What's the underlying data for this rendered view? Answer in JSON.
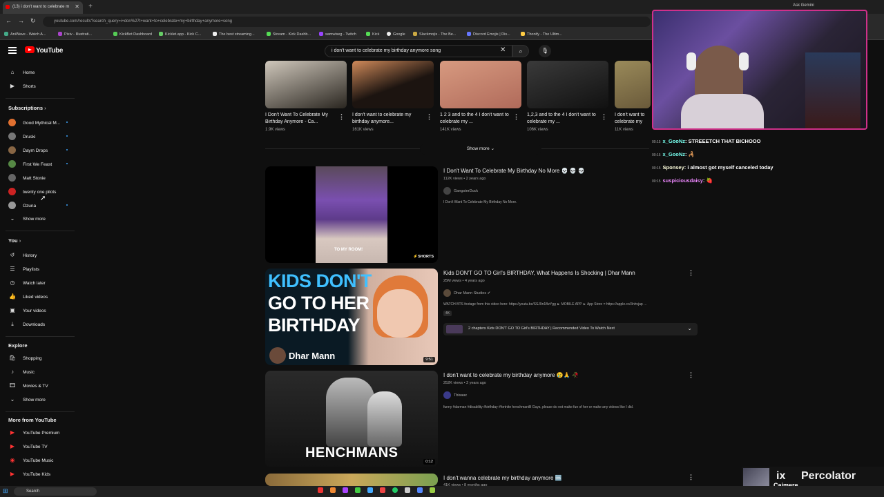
{
  "browser": {
    "tab_title": "(13) i don't want to celebrate m",
    "url": "youtube.com/results?search_query=i+don%27t+want+to+celebrate+my+birthday+anymore+song",
    "ask_gemini": "Ask Gemini",
    "bookmarks": [
      "AniWave - Watch A...",
      "Pixiv - Illustrati...",
      "KickBot Dashboard",
      "Kicklet.app - Kick C...",
      "The best streaming...",
      "Stream - Kick Dashb...",
      "samwiseg - Twitch",
      "Kick",
      "Google",
      "Slackmojis - The Be...",
      "Discord Emojis | Dis...",
      "Thonify - The Ultim..."
    ]
  },
  "header": {
    "logo_text": "YouTube",
    "search_value": "i don't want to celebrate my birthday anymore song"
  },
  "sidebar": {
    "main": [
      {
        "label": "Home",
        "icon": "home-icon"
      },
      {
        "label": "Shorts",
        "icon": "shorts-icon"
      }
    ],
    "subscriptions_heading": "Subscriptions",
    "subscriptions": [
      {
        "label": "Good Mythical M...",
        "color": "#e07030",
        "dot": true
      },
      {
        "label": "Druski",
        "color": "#777777",
        "dot": true
      },
      {
        "label": "Daym Drops",
        "color": "#886644",
        "dot": true
      },
      {
        "label": "First We Feast",
        "color": "#558844",
        "dot": true
      },
      {
        "label": "Matt Stonie",
        "color": "#666666",
        "dot": false
      },
      {
        "label": "twenty one pilots",
        "color": "#cc2222",
        "dot": false
      },
      {
        "label": "Ozuna",
        "color": "#999999",
        "dot": true
      }
    ],
    "show_more": "Show more",
    "you_heading": "You",
    "you_items": [
      {
        "label": "History",
        "icon": "history-icon"
      },
      {
        "label": "Playlists",
        "icon": "playlists-icon"
      },
      {
        "label": "Watch later",
        "icon": "watch-later-icon"
      },
      {
        "label": "Liked videos",
        "icon": "liked-icon"
      },
      {
        "label": "Your videos",
        "icon": "your-videos-icon"
      },
      {
        "label": "Downloads",
        "icon": "downloads-icon"
      }
    ],
    "explore_heading": "Explore",
    "explore_items": [
      {
        "label": "Shopping",
        "icon": "shopping-icon"
      },
      {
        "label": "Music",
        "icon": "music-icon"
      },
      {
        "label": "Movies & TV",
        "icon": "movies-icon"
      }
    ],
    "explore_show_more": "Show more",
    "more_heading": "More from YouTube",
    "more_items": [
      "YouTube Premium",
      "YouTube TV",
      "YouTube Music",
      "YouTube Kids"
    ]
  },
  "shorts_row": [
    {
      "title": "I Don't Want To Celebrate My Birthday Anymore - Ca...",
      "views": "1.9K views",
      "colors": [
        "#cfc7bb",
        "#2a2620"
      ]
    },
    {
      "title": "I don't want to celebrate my birthday anymore...",
      "views": "161K views",
      "colors": [
        "#d08a5a",
        "#1c1410"
      ]
    },
    {
      "title": "1 2 3 and to the 4 I don't want to celebrate my ...",
      "views": "141K views",
      "colors": [
        "#d79a80",
        "#b06a5a"
      ]
    },
    {
      "title": "1,2,3 and to the 4 I don't want to celebrate my ...",
      "views": "106K views",
      "colors": [
        "#3a3a3a",
        "#111111"
      ]
    },
    {
      "title": "I don't want to celebrate my birthday anymore",
      "views": "11K views",
      "colors": [
        "#9a8a5a",
        "#6a5a3a"
      ]
    }
  ],
  "show_more_button": "Show more",
  "results": [
    {
      "title": "I Don't Want To Celebrate My Birthday No More 💀 💀 💀",
      "meta": "112K views • 2 years ago",
      "channel": "GangsterDuck",
      "desc": "I Don't Want To Celebrate My Birthday No More.",
      "badge": "SHORTS",
      "duration": "",
      "thumb_text": "TO MY ROOM!"
    },
    {
      "title": "Kids DON'T GO TO Girl's BIRTHDAY, What Happens Is Shocking | Dhar Mann",
      "meta": "25M views • 4 years ago",
      "channel": "Dhar Mann Studios ✔",
      "desc": "WATCH BTS footage from this video here: https://youtu.be/SSJ9n1BzYgg ► MOBILE APP ► App Store = https://apple.co/3nhvjap ...",
      "tag": "4K",
      "chapters": "2 chapters  Kids DON'T GO TO Girl's BIRTHDAY | Recommended Video To Watch Next",
      "duration": "9:51",
      "thumb_lines": [
        "KIDS DON'T",
        "GO TO HER",
        "BIRTHDAY"
      ],
      "thumb_brand": "Dhar Mann"
    },
    {
      "title": "I don't want to celebrate my birthday anymore 😢🙏 🥀",
      "meta": "252K views • 2 years ago",
      "channel": "Tbisaac",
      "desc": "funny #darman #disability #birthday #fortnite henchmanilil Guys, please do not make fun of her or make any videos like I did.",
      "duration": "0:12",
      "thumb_text": "HENCHMANS"
    },
    {
      "title": "I don't wanna celebrate my birthday anymore 🆒",
      "meta": "41K views • 8 months ago",
      "channel": "",
      "desc": "",
      "duration": ""
    }
  ],
  "overlay": {
    "chat": [
      {
        "name": "x_GooNz",
        "msg": ": STREEETCH THAT BICHOOO"
      },
      {
        "name": "x_GooNz",
        "msg": ": 🦂"
      },
      {
        "name": "Sponsey",
        "msg": ": i almost got myself canceled today"
      },
      {
        "name": "suspiciousdaisy",
        "msg": ": 🍓"
      }
    ],
    "now_playing_title": "Percolator",
    "now_playing_artist": "Cajmere"
  },
  "taskbar": {
    "search_label": "Search"
  }
}
